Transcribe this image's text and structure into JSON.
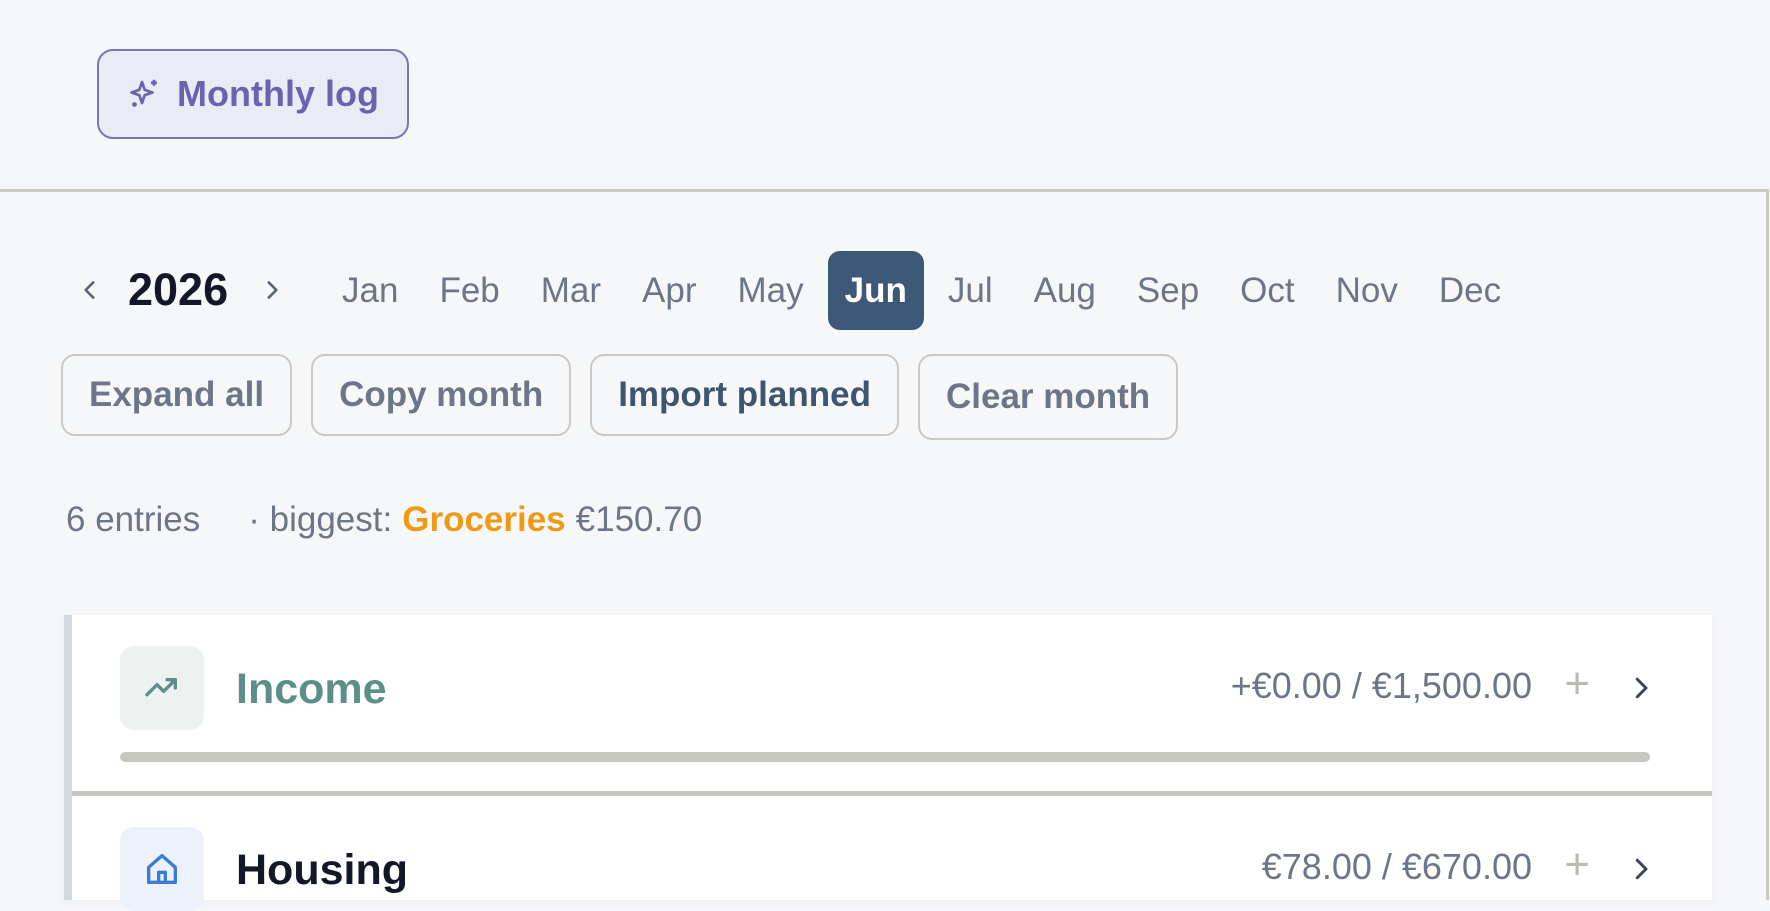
{
  "header": {
    "title": "Monthly log",
    "icon": "sparkles-icon",
    "accent": "#6b63b0"
  },
  "year_nav": {
    "year": "2026",
    "prev_icon": "chevron-left-icon",
    "next_icon": "chevron-right-icon",
    "months": [
      "Jan",
      "Feb",
      "Mar",
      "Apr",
      "May",
      "Jun",
      "Jul",
      "Aug",
      "Sep",
      "Oct",
      "Nov",
      "Dec"
    ],
    "active_month": "Jun",
    "active_color": "#3e5877"
  },
  "actions": {
    "expand_all": "Expand all",
    "copy_month": "Copy month",
    "import_planned": "Import planned",
    "clear_month": "Clear month"
  },
  "summary": {
    "entries": "6 entries",
    "biggest_prefix": "· biggest:",
    "biggest_category": "Groceries",
    "biggest_amount": "€150.70",
    "highlight_color": "#ef9a15"
  },
  "categories": [
    {
      "name": "Income",
      "icon": "trending-up-icon",
      "amount": "+€0.00 / €1,500.00",
      "progress": 0.0,
      "color": "#5c8f87"
    },
    {
      "name": "Housing",
      "icon": "home-icon",
      "amount": "€78.00 / €670.00",
      "color": "#3b7bd6"
    }
  ]
}
